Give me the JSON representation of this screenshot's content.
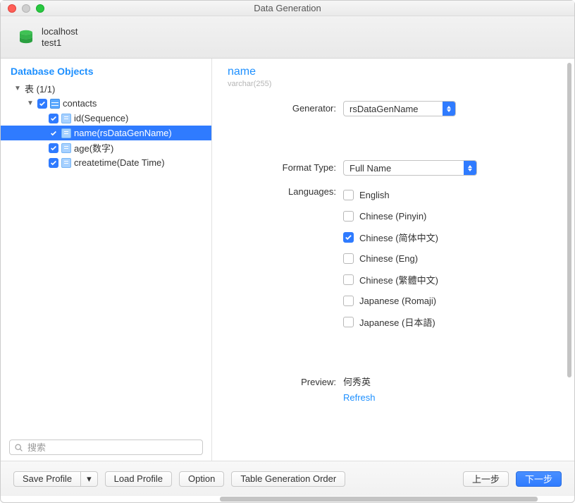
{
  "window": {
    "title": "Data Generation"
  },
  "header": {
    "host": "localhost",
    "schema": "test1"
  },
  "sidebar": {
    "title": "Database Objects",
    "root": {
      "label": "表 (1/1)"
    },
    "table": {
      "label": "contacts"
    },
    "columns": [
      {
        "label": "id(Sequence)"
      },
      {
        "label": "name(rsDataGenName)"
      },
      {
        "label": "age(数字)"
      },
      {
        "label": "createtime(Date Time)"
      }
    ],
    "search_placeholder": "搜索"
  },
  "panel": {
    "title": "name",
    "datatype": "varchar(255)",
    "generator_label": "Generator:",
    "generator_value": "rsDataGenName",
    "format_label": "Format Type:",
    "format_value": "Full Name",
    "languages_label": "Languages:",
    "languages": [
      {
        "label": "English",
        "checked": false
      },
      {
        "label": "Chinese (Pinyin)",
        "checked": false
      },
      {
        "label": "Chinese (简体中文)",
        "checked": true
      },
      {
        "label": "Chinese (Eng)",
        "checked": false
      },
      {
        "label": "Chinese (繁體中文)",
        "checked": false
      },
      {
        "label": "Japanese (Romaji)",
        "checked": false
      },
      {
        "label": "Japanese (日本語)",
        "checked": false
      }
    ],
    "preview_label": "Preview:",
    "preview_value": "何秀英",
    "refresh_label": "Refresh"
  },
  "footer": {
    "save_profile": "Save Profile",
    "dropdown_glyph": "▾",
    "load_profile": "Load Profile",
    "option": "Option",
    "table_order": "Table Generation Order",
    "prev": "上一步",
    "next": "下一步"
  }
}
